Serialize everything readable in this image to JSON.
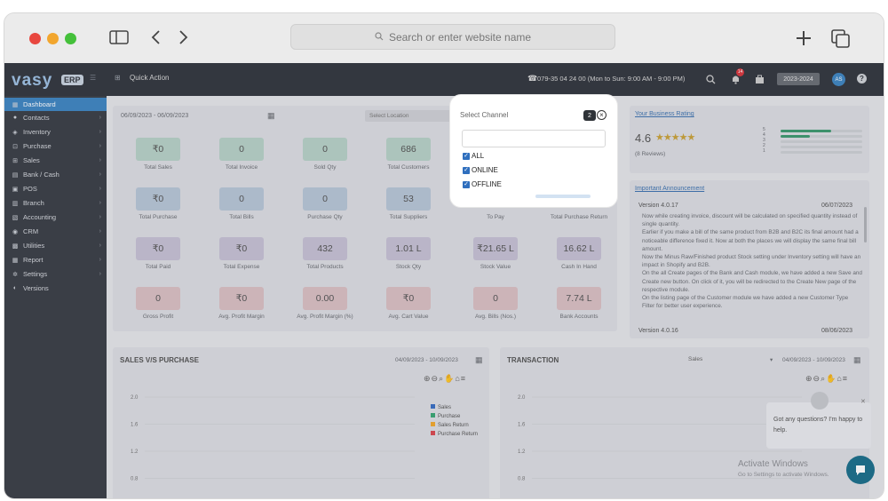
{
  "browser": {
    "search_placeholder": "Search or enter website name",
    "dots": [
      "#e8473f",
      "#f2a62e",
      "#44c03a"
    ]
  },
  "topbar": {
    "logo": "vasy",
    "logo_badge": "ERP",
    "quick_action": "Quick Action",
    "phone": "079-35 04 24 00 (Mon to Sun: 9:00 AM - 9:00 PM)",
    "notification_count": "14",
    "year_range": "2023-2024",
    "avatar": "AS"
  },
  "sidebar": {
    "items": [
      {
        "label": "Dashboard",
        "icon": "dashboard-icon"
      },
      {
        "label": "Contacts",
        "icon": "user-icon"
      },
      {
        "label": "Inventory",
        "icon": "inventory-icon"
      },
      {
        "label": "Purchase",
        "icon": "cart-icon"
      },
      {
        "label": "Sales",
        "icon": "sales-icon"
      },
      {
        "label": "Bank / Cash",
        "icon": "bank-icon"
      },
      {
        "label": "POS",
        "icon": "pos-icon"
      },
      {
        "label": "Branch",
        "icon": "branch-icon"
      },
      {
        "label": "Accounting",
        "icon": "accounting-icon"
      },
      {
        "label": "CRM",
        "icon": "crm-icon"
      },
      {
        "label": "Utilities",
        "icon": "utilities-icon"
      },
      {
        "label": "Report",
        "icon": "report-icon"
      },
      {
        "label": "Settings",
        "icon": "gear-icon"
      },
      {
        "label": "Versions",
        "icon": "versions-icon"
      }
    ]
  },
  "filters": {
    "date_range": "06/09/2023 - 06/09/2023",
    "location_placeholder": "Select Location"
  },
  "stats": [
    {
      "value": "₹0",
      "label": "Total Sales",
      "tone": "g"
    },
    {
      "value": "0",
      "label": "Total Invoice",
      "tone": "g"
    },
    {
      "value": "0",
      "label": "Sold Qty",
      "tone": "g"
    },
    {
      "value": "686",
      "label": "Total Customers",
      "tone": "g"
    },
    {
      "value": "₹0",
      "label": "Total Purchase",
      "tone": "b"
    },
    {
      "value": "0",
      "label": "Total Bills",
      "tone": "b"
    },
    {
      "value": "0",
      "label": "Purchase Qty",
      "tone": "b"
    },
    {
      "value": "53",
      "label": "Total Suppliers",
      "tone": "b"
    },
    {
      "value": "",
      "label": "To Pay",
      "tone": "b"
    },
    {
      "value": "",
      "label": "Total Purchase Return",
      "tone": "b"
    },
    {
      "value": "₹0",
      "label": "Total Paid",
      "tone": "p"
    },
    {
      "value": "₹0",
      "label": "Total Expense",
      "tone": "p"
    },
    {
      "value": "432",
      "label": "Total Products",
      "tone": "p"
    },
    {
      "value": "1.01 L",
      "label": "Stock Qty",
      "tone": "p"
    },
    {
      "value": "₹21.65 L",
      "label": "Stock Value",
      "tone": "p"
    },
    {
      "value": "16.62 L",
      "label": "Cash In Hand",
      "tone": "p"
    },
    {
      "value": "0",
      "label": "Gross Profit",
      "tone": "r"
    },
    {
      "value": "₹0",
      "label": "Avg. Profit Margin",
      "tone": "r"
    },
    {
      "value": "0.00",
      "label": "Avg. Profit Margin (%)",
      "tone": "r"
    },
    {
      "value": "₹0",
      "label": "Avg. Cart Value",
      "tone": "r"
    },
    {
      "value": "0",
      "label": "Avg. Bills (Nos.)",
      "tone": "r"
    },
    {
      "value": "7.74 L",
      "label": "Bank Accounts",
      "tone": "r"
    }
  ],
  "rating": {
    "title": "Your Business Rating",
    "score": "4.6",
    "stars": "★★★★★",
    "reviews": "(8 Reviews)",
    "levels": [
      "5",
      "4",
      "3",
      "2",
      "1"
    ],
    "fractions": [
      0.62,
      0.36,
      0,
      0,
      0
    ]
  },
  "announcement": {
    "title": "Important Announcement",
    "version1": "Version 4.0.17",
    "date1": "06/07/2023",
    "bullets": [
      "Now while creating invoice, discount will be calculated on specified quantity instead of single quantity.",
      "Earlier if you make a bill of the same product from B2B and B2C its final amount had a noticeable difference fixed it. Now at both the places we will display the same final bill amount.",
      "Now the Minus Raw/Finished product Stock setting under Inventory setting will have an impact in Shopify and B2B.",
      "On the all Create pages of the Bank and Cash module, we have added a new Save and Create new button. On click of it, you will be redirected to the Create New page of the respective module.",
      "On the listing page of the Customer module we have added a new Customer Type Filter for better user experience."
    ],
    "version2": "Version 4.0.16",
    "date2": "08/06/2023"
  },
  "sales_chart": {
    "title": "SALES V/S PURCHASE",
    "date_range": "04/09/2023 - 10/09/2023",
    "y_ticks": [
      "2.0",
      "1.6",
      "1.2",
      "0.8",
      "0.4"
    ]
  },
  "transaction": {
    "title": "TRANSACTION",
    "select_value": "Sales",
    "date_range": "04/09/2023 - 10/09/2023",
    "y_ticks": [
      "2.0",
      "1.6",
      "1.2",
      "0.8",
      "0.4"
    ],
    "legend_partial": [
      "up",
      "Inflow",
      "Rap",
      "Othe"
    ]
  },
  "chart_data": {
    "type": "bar",
    "title": "SALES V/S PURCHASE",
    "xlabel": "",
    "ylabel": "",
    "ylim": [
      0,
      2.0
    ],
    "grid": true,
    "legend_position": "top-right",
    "categories": [],
    "series": [
      {
        "name": "Sales",
        "values": [],
        "color": "#3a6fc4"
      },
      {
        "name": "Purchase",
        "values": [],
        "color": "#3ba775"
      },
      {
        "name": "Sales Return",
        "values": [],
        "color": "#f1a92f"
      },
      {
        "name": "Purchase Return",
        "values": [],
        "color": "#d94a52"
      }
    ]
  },
  "chat": {
    "message": "Got any questions? I'm happy to help."
  },
  "watermark": {
    "line1": "Activate Windows",
    "line2": "Go to Settings to activate Windows."
  },
  "popup": {
    "title": "Select Channel",
    "count": "2",
    "options": [
      {
        "label": "ALL",
        "checked": true
      },
      {
        "label": "ONLINE",
        "checked": true
      },
      {
        "label": "OFFLINE",
        "checked": true
      }
    ]
  }
}
